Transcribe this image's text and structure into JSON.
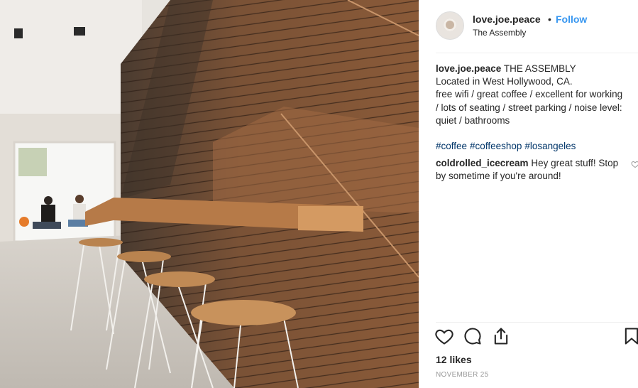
{
  "post": {
    "username": "love.joe.peace",
    "follow_label": "Follow",
    "dot": "•",
    "location": "The Assembly",
    "caption": {
      "username": "love.joe.peace",
      "lines": [
        "THE ASSEMBLY",
        "Located in West Hollywood, CA.",
        "free wifi / great coffee / excellent for working",
        "/ lots of seating / street parking / noise level:",
        "quiet / bathrooms"
      ],
      "hashtags": [
        "#coffee",
        "#coffeeshop",
        "#losangeles"
      ]
    },
    "comment": {
      "username": "coldrolled_icecream",
      "lines": [
        "Hey great stuff! Stop",
        "by sometime if you're around!"
      ]
    },
    "likes": "12 likes",
    "date": "NOVEMBER 25"
  },
  "icons": [
    "like-heart-icon",
    "comment-icon",
    "share-icon",
    "bookmark-icon",
    "comment-like-heart-icon"
  ],
  "colors": {
    "link": "#3897f0",
    "hashtag": "#003569",
    "text": "#262626",
    "muted": "#999999"
  }
}
